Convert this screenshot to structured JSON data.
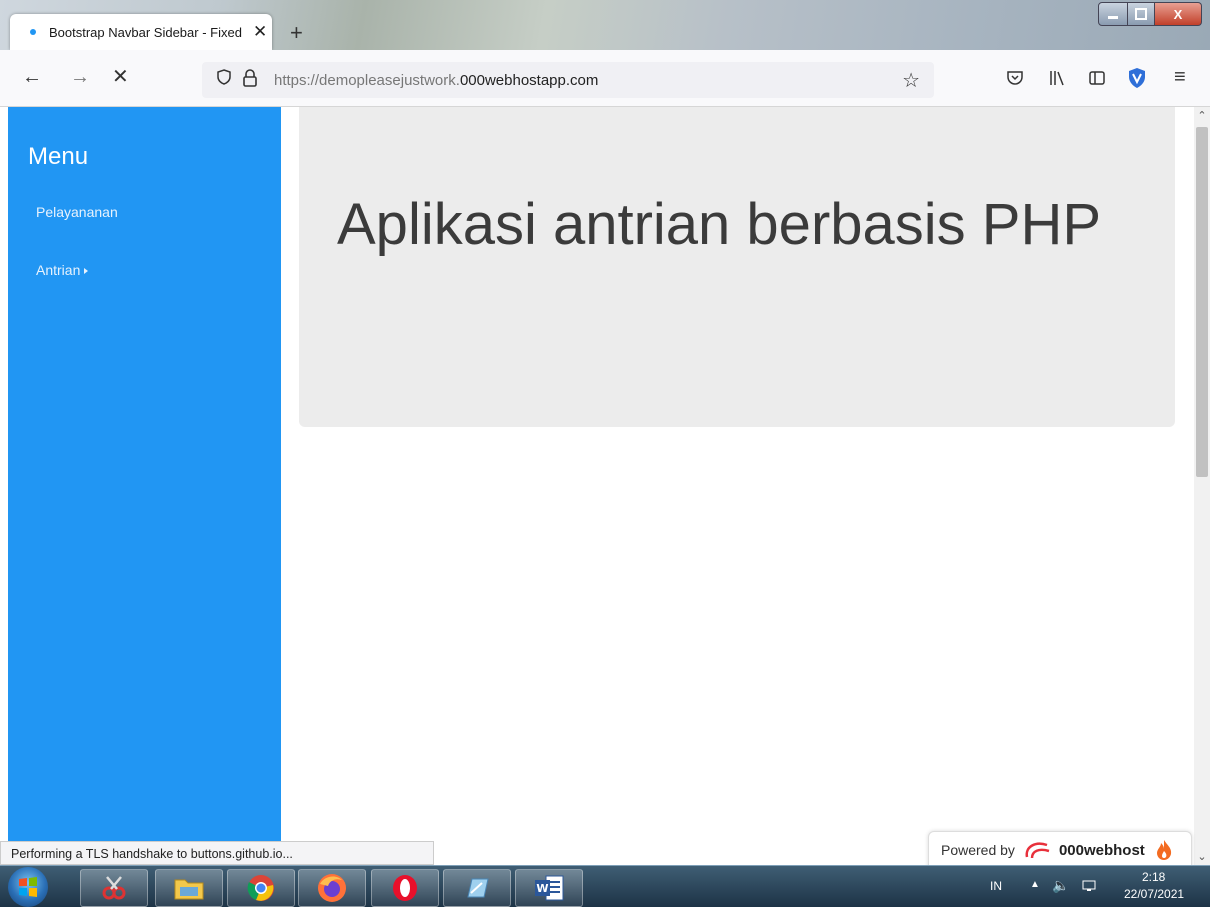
{
  "browser": {
    "tab_title": "Bootstrap Navbar Sidebar - Fixed",
    "tab_close": "✕",
    "new_tab": "+",
    "url_prefix": "https://demopleasejustwork.",
    "url_domain": "000webhostapp.com",
    "nav_back": "←",
    "nav_forward": "→",
    "nav_stop": "✕",
    "star_icon": "☆",
    "pocket_icon": "pocket-icon",
    "library_icon": "library-icon",
    "sidebar_icon": "sidebar-icon",
    "extension_icon": "shield-extension-icon",
    "menu_icon": "≡"
  },
  "window": {
    "min": "—",
    "max": "□",
    "close": "X"
  },
  "sidebar": {
    "title": "Menu",
    "items": [
      {
        "label": "Pelayananan"
      },
      {
        "label": "Antrian"
      }
    ]
  },
  "main": {
    "heading": "Aplikasi antrian berbasis PHP"
  },
  "status": {
    "text": "Performing a TLS handshake to buttons.github.io..."
  },
  "powered": {
    "label": "Powered by",
    "brand": "000webhost"
  },
  "taskbar": {
    "lang": "IN",
    "time": "2:18",
    "date": "22/07/2021"
  },
  "colors": {
    "sidebar": "#2196f3",
    "jumbotron": "#ececec"
  }
}
